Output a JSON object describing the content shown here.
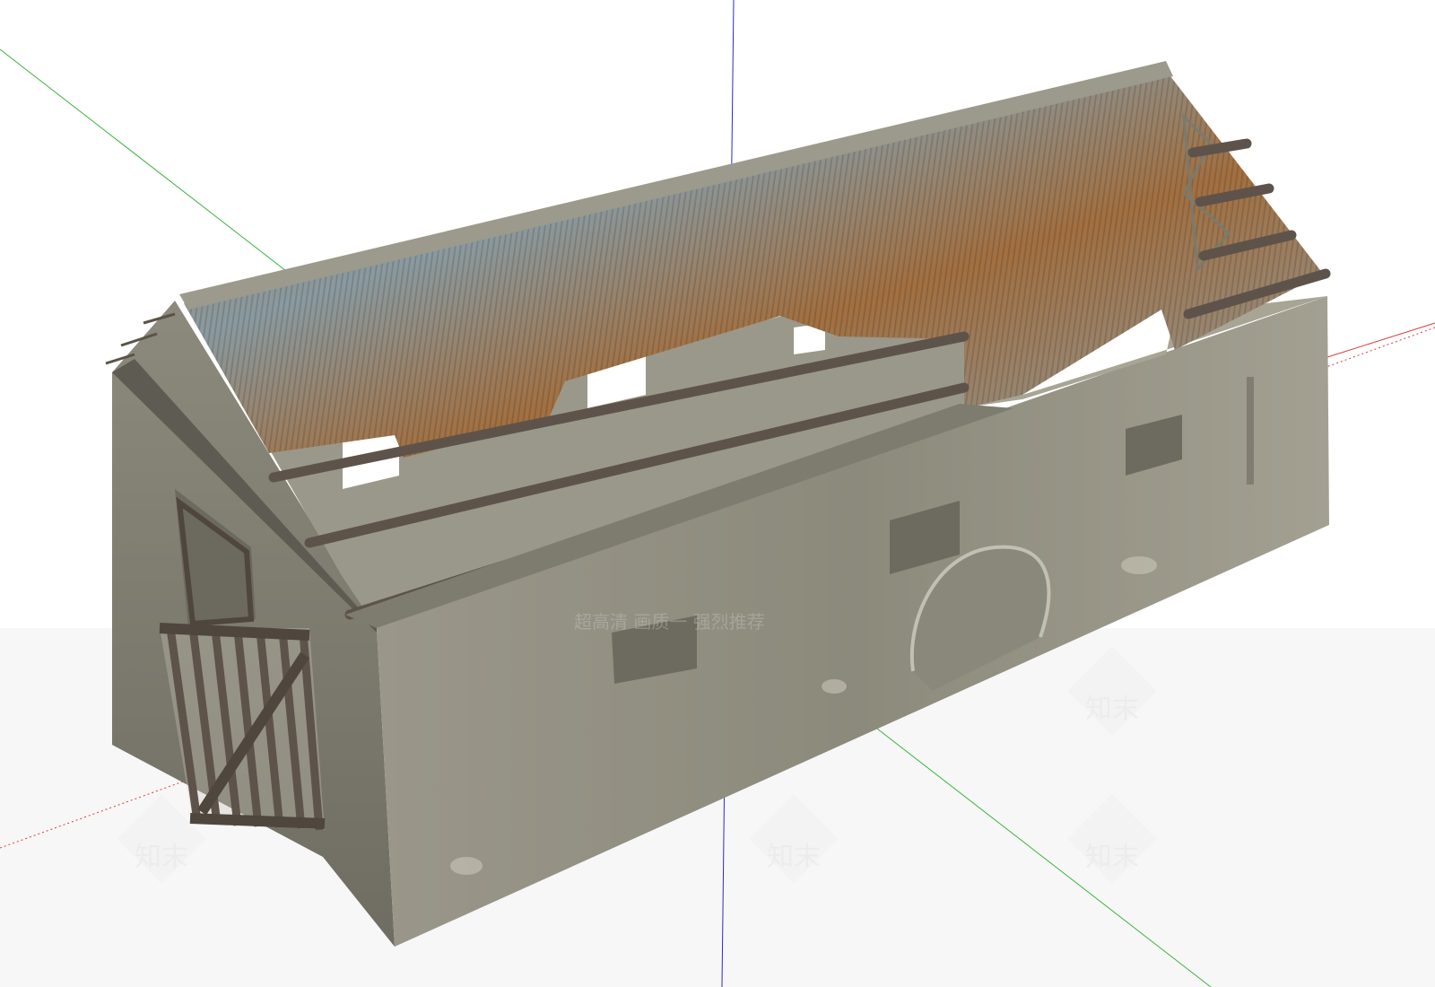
{
  "scene": {
    "subject": "ruined stone barn with corrugated metal roof",
    "background_color": "#ffffff",
    "ground_color": "#f7f7f7"
  },
  "axes": {
    "x_color": "#e03a3a",
    "y_color": "#3db33d",
    "z_color": "#2a2ad0"
  },
  "materials": {
    "wall_plaster": "#8f8c7c",
    "wall_shadow": "#6f6c60",
    "roof_rust": "#9a6a3a",
    "roof_steel": "#8a9aa0",
    "timber": "#5e534a"
  },
  "watermarks": {
    "brand_text": "知末",
    "overlay_text": "超高清  画质一  强烈推荐"
  }
}
